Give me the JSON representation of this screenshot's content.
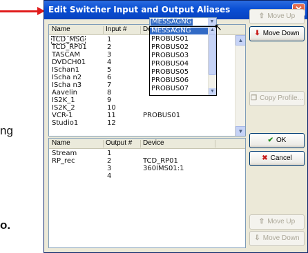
{
  "background": {
    "fragment_ng": "ng",
    "fragment_o": "o."
  },
  "window": {
    "title": "Edit Switcher Input and Output Aliases",
    "close_glyph": "✕"
  },
  "inputs": {
    "headers": {
      "name": "Name",
      "number": "Input #",
      "device": "Device"
    },
    "rows": [
      {
        "name": "TCD_MSG",
        "number": "1",
        "device": ""
      },
      {
        "name": "TCD_RP01",
        "number": "2",
        "device": ""
      },
      {
        "name": "TASCAM",
        "number": "3",
        "device": ""
      },
      {
        "name": "DVDCH01",
        "number": "4",
        "device": ""
      },
      {
        "name": "ISchan1",
        "number": "5",
        "device": ""
      },
      {
        "name": "IScha n2",
        "number": "6",
        "device": ""
      },
      {
        "name": "IScha n3",
        "number": "7",
        "device": ""
      },
      {
        "name": "Aavelin",
        "number": "8",
        "device": ""
      },
      {
        "name": "IS2K_1",
        "number": "9",
        "device": ""
      },
      {
        "name": "IS2K_2",
        "number": "10",
        "device": ""
      },
      {
        "name": "VCR-1",
        "number": "11",
        "device": "PROBUS01"
      },
      {
        "name": "Studio1",
        "number": "12",
        "device": ""
      }
    ]
  },
  "device_combo": {
    "value": "MESSAGNG",
    "options": [
      "MESSAGNG",
      "PROBUS01",
      "PROBUS02",
      "PROBUS03",
      "PROBUS04",
      "PROBUS05",
      "PROBUS06",
      "PROBUS07"
    ],
    "selected_index": 0
  },
  "outputs": {
    "headers": {
      "name": "Name",
      "number": "Output #",
      "device": "Device"
    },
    "rows": [
      {
        "name": "Stream",
        "number": "1",
        "device": ""
      },
      {
        "name": "RP_rec",
        "number": "2",
        "device": "TCD_RP01"
      },
      {
        "name": "",
        "number": "3",
        "device": "360IMS01:1"
      },
      {
        "name": "",
        "number": "4",
        "device": ""
      }
    ]
  },
  "buttons": {
    "move_up_top": "Move Up",
    "move_down_top": "Move Down",
    "copy_profile": "Copy Profile...",
    "ok": "OK",
    "cancel": "Cancel",
    "move_up_bottom": "Move Up",
    "move_down_bottom": "Move Down"
  },
  "icons": {
    "move_up": "up-arrow-icon",
    "move_down": "down-arrow-icon",
    "copy": "copy-icon",
    "ok": "checkmark-icon",
    "cancel": "x-icon"
  },
  "colors": {
    "title_bar": "#0a4fd4",
    "selection": "#316ac5",
    "annotation_arrow": "#e01b1b",
    "dialog_face": "#ece9d8"
  }
}
